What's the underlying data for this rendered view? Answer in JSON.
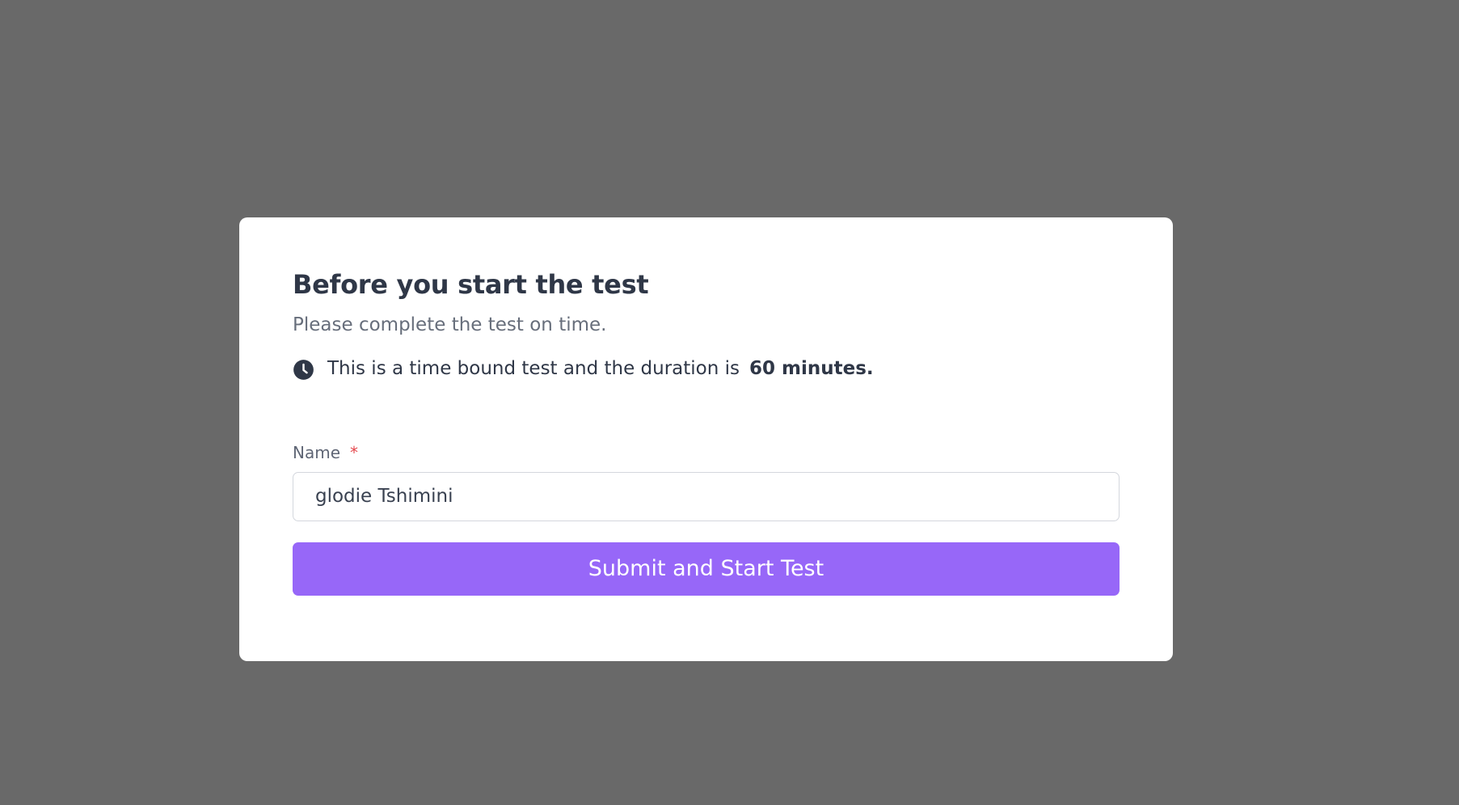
{
  "page": {
    "background_color": "#696969"
  },
  "modal": {
    "title": "Before you start the test",
    "subtitle": "Please complete the test on time.",
    "duration": {
      "icon": "clock-icon",
      "text": "This is a time bound test and the duration is",
      "value": "60 minutes."
    },
    "form": {
      "name_label": "Name",
      "required_marker": "*",
      "name_value": "glodie Tshimini"
    },
    "submit_label": "Submit and Start Test",
    "accent_color": "#9767f8"
  }
}
